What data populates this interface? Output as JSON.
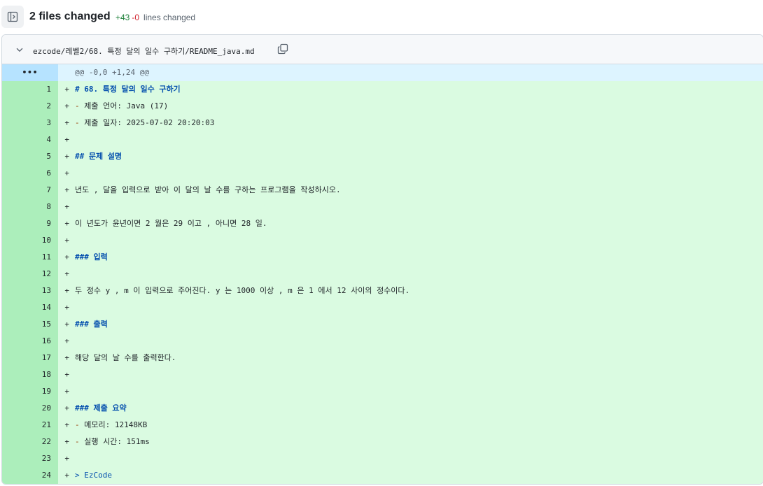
{
  "header": {
    "files_changed": "2 files changed",
    "additions": "+43",
    "deletions": "-0",
    "lines_label": "lines changed"
  },
  "file": {
    "path": "ezcode/레벨2/68. 특정 달의 일수 구하기/README_java.md",
    "hunk_marker": "•••",
    "hunk_header": "@@ -0,0 +1,24 @@"
  },
  "lines": [
    {
      "n": "1",
      "mark": "+",
      "style": "h",
      "text": "# 68. 특정 달의 일수 구하기"
    },
    {
      "n": "2",
      "mark": "+",
      "style": "li",
      "prefix": "- ",
      "text": "제출 언어: Java (17)"
    },
    {
      "n": "3",
      "mark": "+",
      "style": "li",
      "prefix": "- ",
      "text": "제출 일자: 2025-07-02 20:20:03"
    },
    {
      "n": "4",
      "mark": "+",
      "style": "",
      "text": ""
    },
    {
      "n": "5",
      "mark": "+",
      "style": "h",
      "text": "## 문제 설명"
    },
    {
      "n": "6",
      "mark": "+",
      "style": "",
      "text": ""
    },
    {
      "n": "7",
      "mark": "+",
      "style": "",
      "text": "년도 , 달을 입력으로 받아 이 달의 날 수를 구하는 프로그램을 작성하시오."
    },
    {
      "n": "8",
      "mark": "+",
      "style": "",
      "text": ""
    },
    {
      "n": "9",
      "mark": "+",
      "style": "",
      "text": "이 년도가 윤년이면 2 월은 29 이고 , 아니면 28 일."
    },
    {
      "n": "10",
      "mark": "+",
      "style": "",
      "text": ""
    },
    {
      "n": "11",
      "mark": "+",
      "style": "h",
      "text": "### 입력"
    },
    {
      "n": "12",
      "mark": "+",
      "style": "",
      "text": ""
    },
    {
      "n": "13",
      "mark": "+",
      "style": "",
      "text": "두 정수 y , m 이 입력으로 주어진다. y 는 1000 이상 , m 은 1 에서 12 사이의 정수이다."
    },
    {
      "n": "14",
      "mark": "+",
      "style": "",
      "text": ""
    },
    {
      "n": "15",
      "mark": "+",
      "style": "h",
      "text": "### 출력"
    },
    {
      "n": "16",
      "mark": "+",
      "style": "",
      "text": ""
    },
    {
      "n": "17",
      "mark": "+",
      "style": "",
      "text": "해당 달의 날 수를 출력한다."
    },
    {
      "n": "18",
      "mark": "+",
      "style": "",
      "text": ""
    },
    {
      "n": "19",
      "mark": "+",
      "style": "",
      "text": ""
    },
    {
      "n": "20",
      "mark": "+",
      "style": "h",
      "text": "### 제출 요약"
    },
    {
      "n": "21",
      "mark": "+",
      "style": "li",
      "prefix": "- ",
      "text": "메모리: 12148KB"
    },
    {
      "n": "22",
      "mark": "+",
      "style": "li",
      "prefix": "- ",
      "text": "실행 시간: 151ms"
    },
    {
      "n": "23",
      "mark": "+",
      "style": "",
      "text": ""
    },
    {
      "n": "24",
      "mark": "+",
      "style": "q",
      "text": "> EzCode"
    }
  ]
}
